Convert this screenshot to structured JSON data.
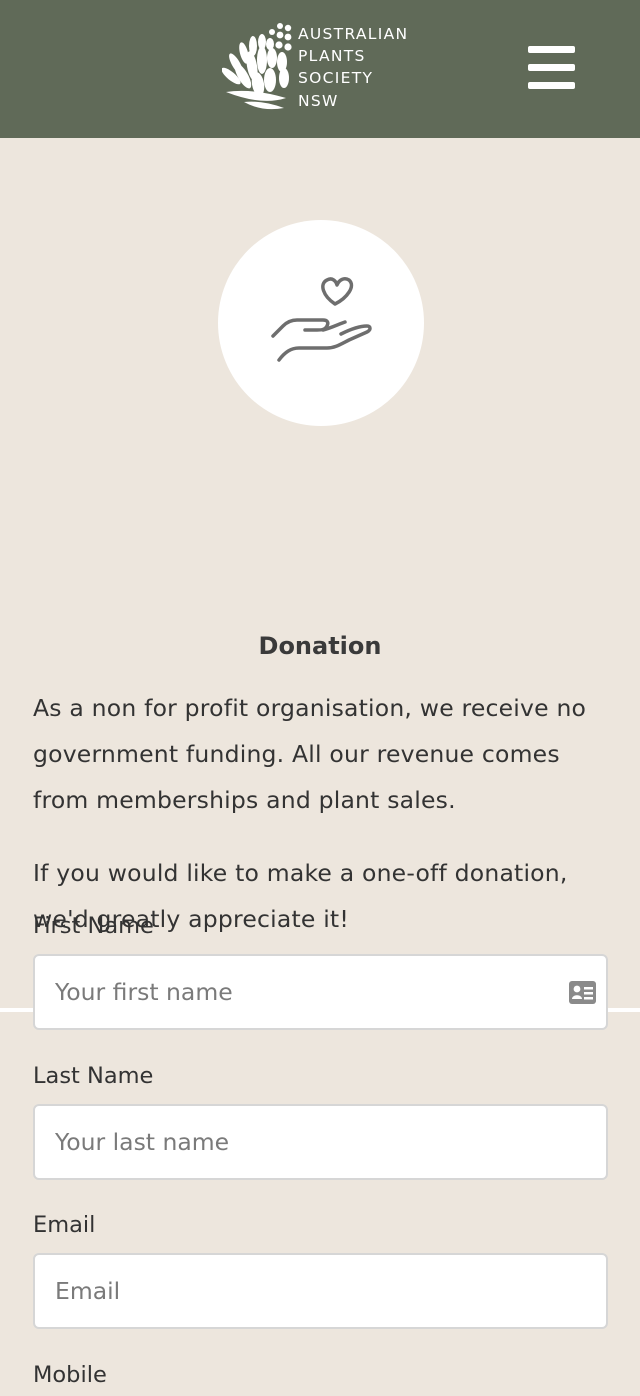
{
  "header": {
    "logo_lines": [
      "AUSTRALIAN",
      "PLANTS",
      "SOCIETY",
      "NSW"
    ],
    "menu_icon": "hamburger-menu-icon",
    "bg_color": "#606a58"
  },
  "donation": {
    "icon": "hand-heart-icon",
    "title": "Donation",
    "paragraph_1": "As a non for profit organisation, we receive no government funding. All our revenue comes from memberships and plant sales.",
    "paragraph_2": "If you would like to make a one-off donation, we'd greatly appreciate it!"
  },
  "form": {
    "first_name": {
      "label": "First Name",
      "placeholder": "Your first name",
      "value": ""
    },
    "last_name": {
      "label": "Last Name",
      "placeholder": "Your last name",
      "value": ""
    },
    "email": {
      "label": "Email",
      "placeholder": "Email",
      "value": ""
    },
    "mobile": {
      "label": "Mobile"
    }
  },
  "colors": {
    "page_bg": "#ede6dd",
    "header_bg": "#606a58",
    "text": "#333333"
  }
}
